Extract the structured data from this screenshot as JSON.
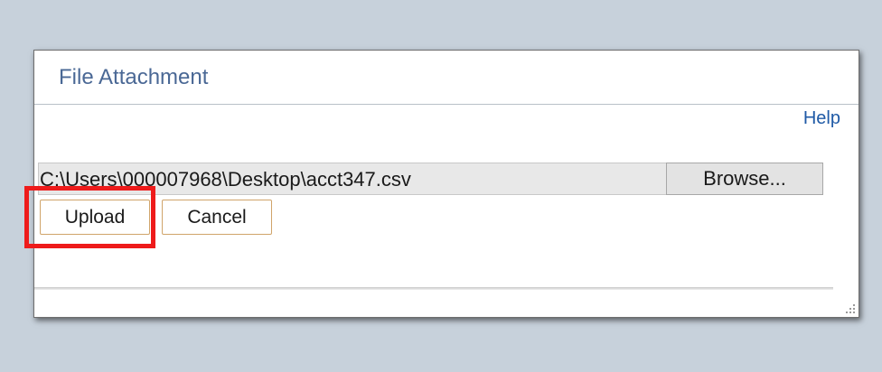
{
  "dialog": {
    "title": "File Attachment",
    "help_label": "Help",
    "file_path": "C:\\Users\\000007968\\Desktop\\acct347.csv",
    "browse_label": "Browse...",
    "upload_label": "Upload",
    "cancel_label": "Cancel"
  },
  "colors": {
    "page_background": "#c7d1db",
    "title_text": "#4a6895",
    "help_link": "#1f5aa6",
    "highlight": "#ee1b1b",
    "button_border": "#d0a46a"
  }
}
